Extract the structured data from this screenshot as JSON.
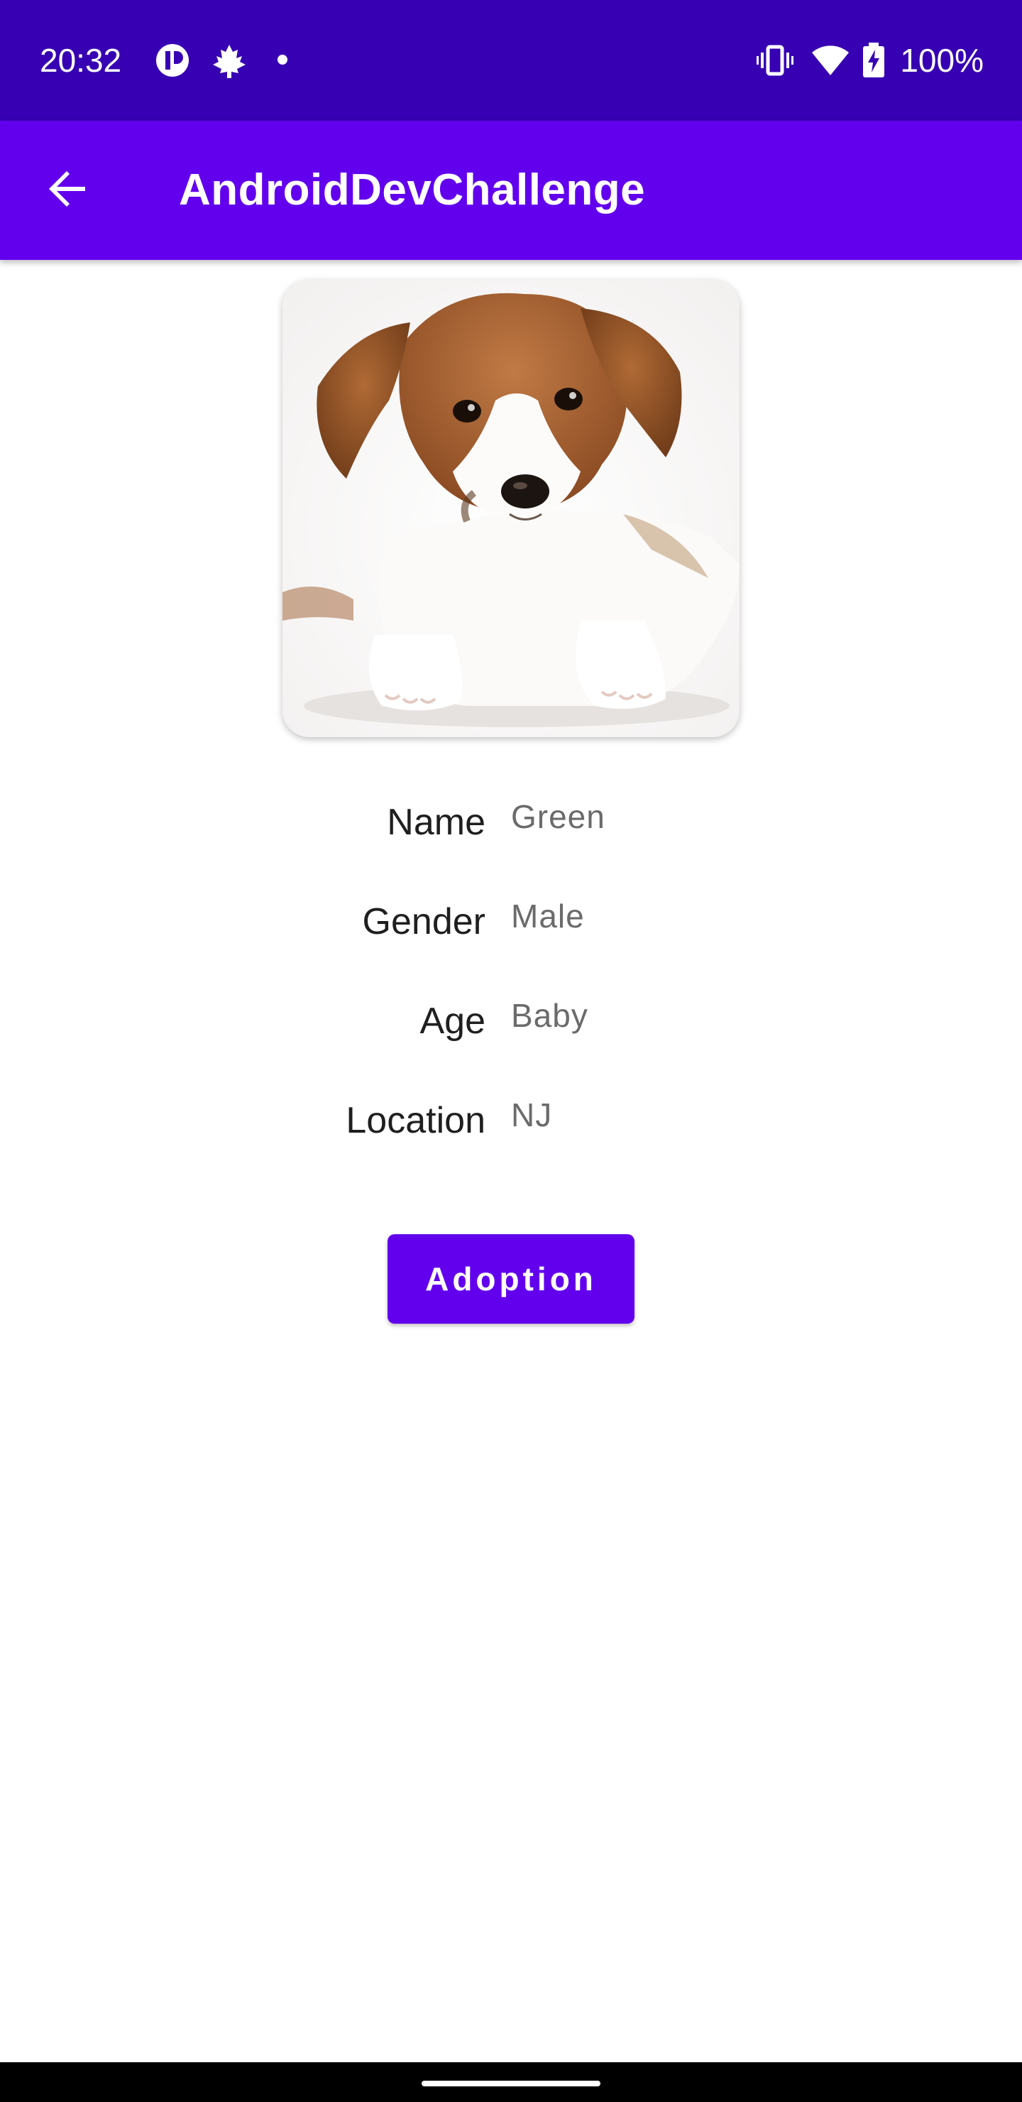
{
  "status_bar": {
    "time": "20:32",
    "battery_text": "100%",
    "icons": [
      "pause-circle-icon",
      "maple-leaf-icon",
      "dot-icon",
      "vibrate-icon",
      "wifi-icon",
      "battery-charging-icon"
    ],
    "background": "#3700b3"
  },
  "app_bar": {
    "title": "AndroidDevChallenge",
    "back_icon": "arrow-back-icon",
    "background": "#6200ee"
  },
  "pet": {
    "photo": "puppy-photo",
    "details": [
      {
        "label": "Name",
        "value": "Green"
      },
      {
        "label": "Gender",
        "value": "Male"
      },
      {
        "label": "Age",
        "value": "Baby"
      },
      {
        "label": "Location",
        "value": "NJ"
      }
    ]
  },
  "actions": {
    "adopt_label": "Adoption",
    "accent": "#6200ee"
  }
}
